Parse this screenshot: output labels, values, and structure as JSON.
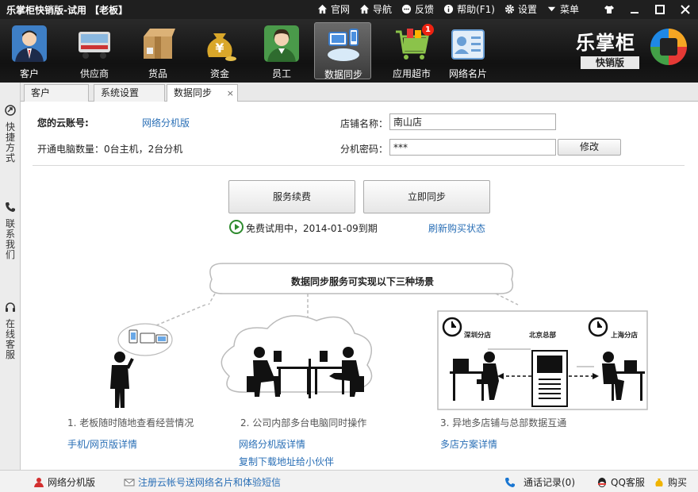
{
  "titlebar": {
    "title": "乐掌柜快销版-试用 【老板】",
    "menu": [
      {
        "icon": "home-icon",
        "label": "官网"
      },
      {
        "icon": "home-icon",
        "label": "导航"
      },
      {
        "icon": "chat-icon",
        "label": "反馈"
      },
      {
        "icon": "info-icon",
        "label": "帮助(F1)"
      },
      {
        "icon": "gear-icon",
        "label": "设置"
      },
      {
        "icon": "menu-icon",
        "label": "菜单"
      }
    ]
  },
  "toolbar": {
    "items": [
      {
        "label": "客户",
        "icon": "customer-icon"
      },
      {
        "label": "供应商",
        "icon": "supplier-truck-icon"
      },
      {
        "label": "货品",
        "icon": "goods-box-icon"
      },
      {
        "label": "资金",
        "icon": "money-bag-icon"
      },
      {
        "label": "员工",
        "icon": "employee-icon"
      },
      {
        "label": "数据同步",
        "icon": "data-sync-icon",
        "active": true
      },
      {
        "label": "应用超市",
        "icon": "app-market-cart-icon",
        "badge": "1"
      },
      {
        "label": "网络名片",
        "icon": "business-card-icon"
      }
    ],
    "brand": {
      "name": "乐掌柜",
      "sub": "快销版"
    }
  },
  "sidebar": {
    "items": [
      {
        "icon": "shortcut-icon",
        "label": "快捷方式"
      },
      {
        "icon": "phone-icon",
        "label": "联系我们"
      },
      {
        "icon": "headset-icon",
        "label": "在线客服"
      }
    ]
  },
  "tabs": [
    {
      "label": "客户"
    },
    {
      "label": "系统设置"
    },
    {
      "label": "数据同步",
      "active": true,
      "close": "×"
    }
  ],
  "form": {
    "account_label": "您的云账号:",
    "account_value": "网络分机版",
    "pc_count": "开通电脑数量：0台主机，2台分机",
    "store_label": "店铺名称：",
    "store_value": "南山店",
    "password_label": "分机密码：",
    "password_value": "***",
    "modify_button": "修改"
  },
  "actions": {
    "renew_button": "服务续费",
    "sync_button": "立即同步",
    "trial_text": "免费试用中，2014-01-09到期",
    "refresh_link": "刷新购买状态"
  },
  "scenarios": {
    "headline": "数据同步服务可实现以下三种场景",
    "items": [
      {
        "caption": "1. 老板随时随地查看经营情况",
        "links": [
          "手机/网页版详情"
        ]
      },
      {
        "caption": "2. 公司内部多台电脑同时操作",
        "links": [
          "网络分机版详情",
          "复制下载地址给小伙伴"
        ]
      },
      {
        "caption": "3. 异地多店铺与总部数据互通",
        "links": [
          "多店方案详情"
        ]
      }
    ],
    "map_labels": {
      "shenzhen": "深圳分店",
      "beijing": "北京总部",
      "shanghai": "上海分店"
    }
  },
  "statusbar": {
    "left_item": "网络分机版",
    "promo_link": "注册云帐号送网络名片和体验短信",
    "call_log": "通话记录(0)",
    "qq_service": "QQ客服",
    "buy": "购买"
  },
  "colors": {
    "link": "#2a6fb6",
    "titlebar": "#1f1f1f",
    "toolbar": "#111111",
    "badge": "#ee2211"
  }
}
